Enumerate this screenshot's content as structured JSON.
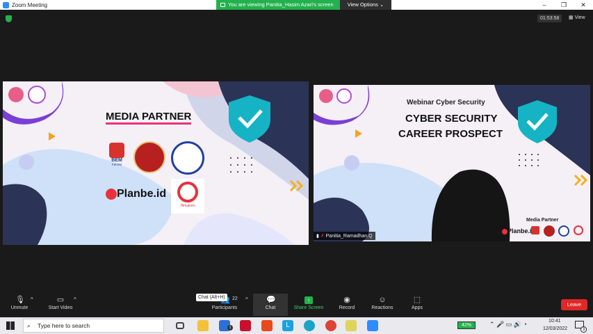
{
  "window": {
    "title": "Zoom Meeting"
  },
  "share": {
    "banner": "You are viewing Panitia_Hasim Azari's screen",
    "view_options": "View Options"
  },
  "header": {
    "timer": "01:53:58",
    "view": "View"
  },
  "slide1": {
    "title": "MEDIA PARTNER",
    "bem": "BEM",
    "fikom": "FIKOM",
    "planbe": "Planbe.id",
    "himakom": "Himakom"
  },
  "slide2": {
    "webinar": "Webinar Cyber Security",
    "title1": "CYBER SECURITY",
    "title2": "CAREER PROSPECT",
    "media_partner": "Media Partner",
    "planbe": "Planbe.id"
  },
  "participant": {
    "name": "Panitia_Ramadhan Q"
  },
  "toolbar": {
    "unmute": "Unmute",
    "start_video": "Start Video",
    "participants": "Participants",
    "participants_count": "22",
    "chat": "Chat",
    "share_screen": "Share Screen",
    "record": "Record",
    "reactions": "Reactions",
    "apps": "Apps",
    "leave": "Leave",
    "chat_tooltip": "Chat (Alt+H)"
  },
  "taskbar": {
    "search_placeholder": "Type here to search",
    "battery": "42%",
    "time": "10:41",
    "date": "12/03/2022",
    "notif_count": "3"
  }
}
